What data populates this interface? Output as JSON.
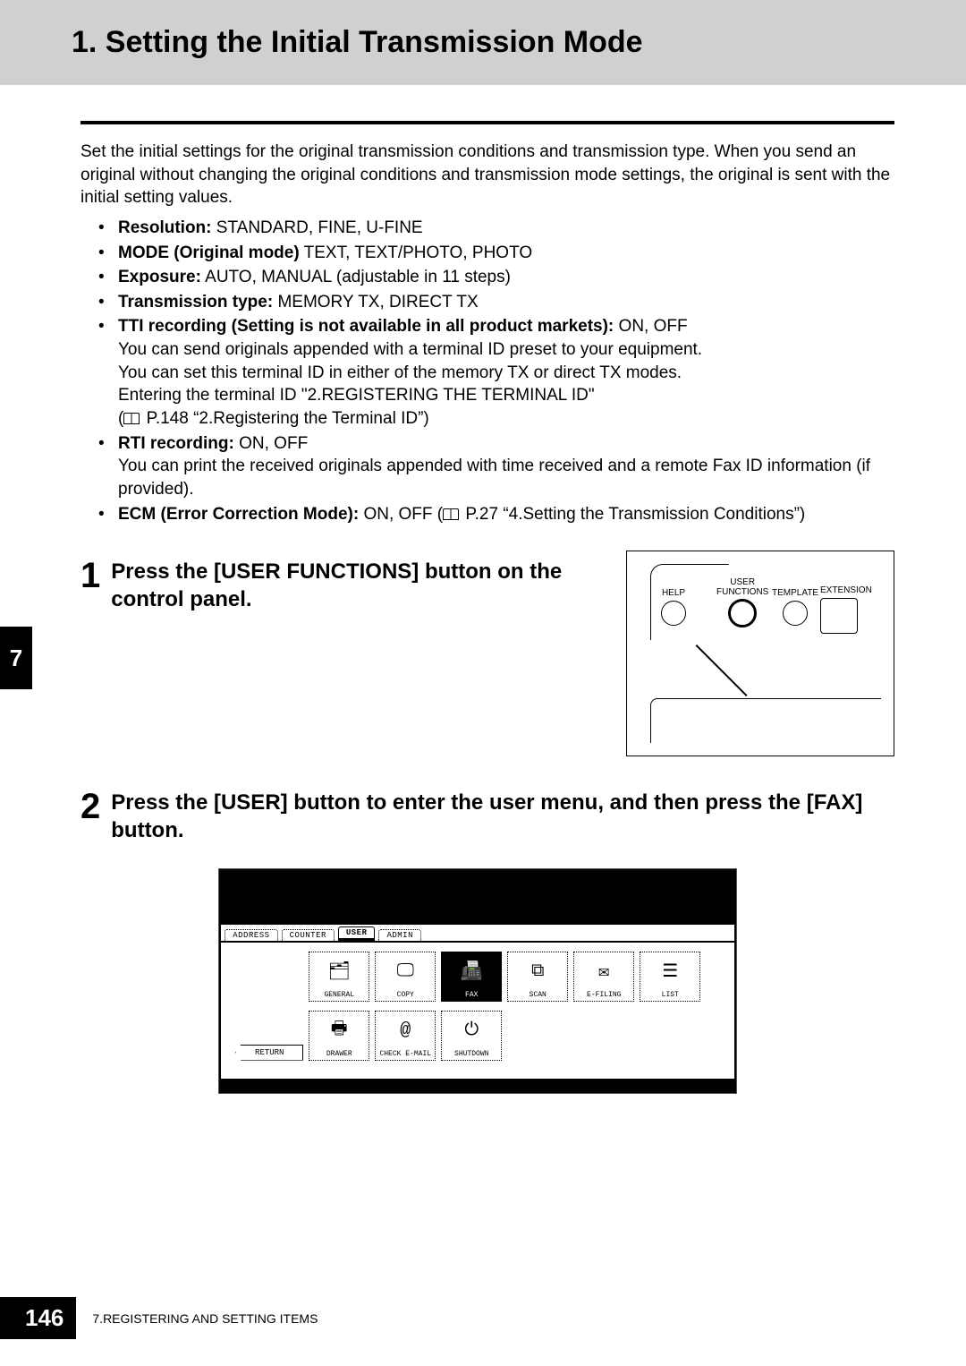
{
  "header": {
    "title": "1. Setting the Initial Transmission Mode"
  },
  "intro": "Set the initial settings for the original transmission conditions and transmission type. When you send an original without changing the original conditions and transmission mode settings, the original is sent with the initial setting values.",
  "settings": {
    "resolution": {
      "label": "Resolution:",
      "values": " STANDARD, FINE, U-FINE"
    },
    "mode": {
      "label": "MODE (Original mode)",
      "values": " TEXT, TEXT/PHOTO, PHOTO"
    },
    "exposure": {
      "label": "Exposure:",
      "values": " AUTO, MANUAL (adjustable in 11 steps)"
    },
    "txtype": {
      "label": "Transmission type:",
      "values": " MEMORY TX, DIRECT TX"
    },
    "tti": {
      "label": "TTI recording (Setting is not available in all product markets):",
      "values": " ON, OFF",
      "line1": "You can send originals appended with a terminal ID preset to your equipment.",
      "line2": "You can set this terminal ID in either of the memory TX or direct TX modes.",
      "line3": "Entering the terminal ID \"2.REGISTERING THE TERMINAL ID\"",
      "line4_ref": " P.148 “2.Registering the Terminal ID”)"
    },
    "rti": {
      "label": "RTI recording:",
      "values": " ON, OFF",
      "line1": "You can print the received originals appended with time received and a remote Fax ID information (if provided)."
    },
    "ecm": {
      "label": "ECM (Error Correction Mode):",
      "values": " ON, OFF (",
      "ref": " P.27 “4.Setting the Transmission Conditions”)"
    }
  },
  "steps": {
    "s1": {
      "num": "1",
      "title": "Press the [USER FUNCTIONS] button on the control panel."
    },
    "s2": {
      "num": "2",
      "title": "Press the [USER] button to enter the user menu, and then press the [FAX] button."
    }
  },
  "panel": {
    "help": "HELP",
    "user_l1": "USER",
    "user_l2": "FUNCTIONS",
    "template": "TEMPLATE",
    "extension": "EXTENSION"
  },
  "screen": {
    "tabs": {
      "address": "ADDRESS",
      "counter": "COUNTER",
      "user": "USER",
      "admin": "ADMIN"
    },
    "row1": {
      "general": "GENERAL",
      "copy": "COPY",
      "fax": "FAX",
      "scan": "SCAN",
      "efiling": "E-FILING",
      "list": "LIST"
    },
    "row2": {
      "drawer": "DRAWER",
      "checkemail": "CHECK E-MAIL",
      "shutdown": "SHUTDOWN"
    },
    "return": "RETURN"
  },
  "side_tab": "7",
  "footer": {
    "page": "146",
    "chapter": "7.REGISTERING AND SETTING ITEMS"
  }
}
